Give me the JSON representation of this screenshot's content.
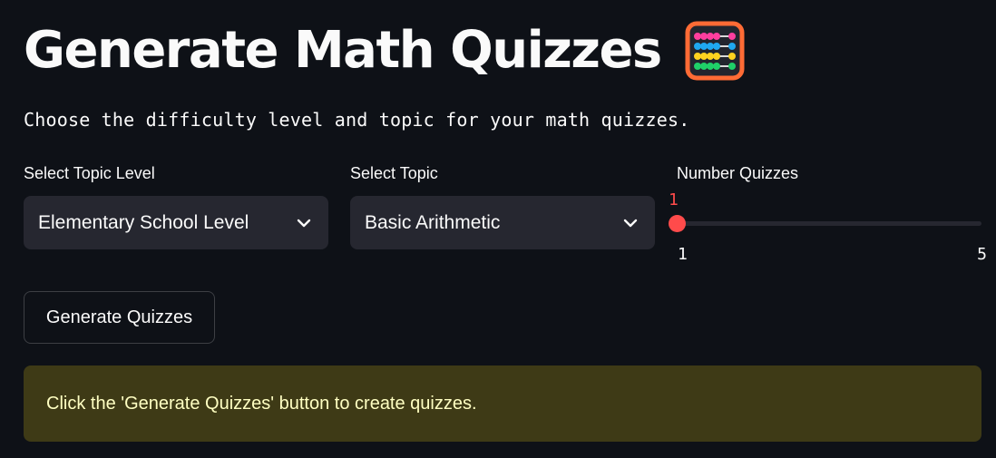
{
  "header": {
    "title": "Generate Math Quizzes",
    "title_icon": "abacus-icon",
    "subtitle": "Choose the difficulty level and topic for your math quizzes."
  },
  "controls": {
    "topic_level": {
      "label": "Select Topic Level",
      "value": "Elementary School Level",
      "icon": "chevron-down-icon"
    },
    "topic": {
      "label": "Select Topic",
      "value": "Basic Arithmetic",
      "icon": "chevron-down-icon"
    },
    "number_quizzes": {
      "label": "Number Quizzes",
      "value": "1",
      "min": "1",
      "max": "5"
    }
  },
  "actions": {
    "generate_label": "Generate Quizzes"
  },
  "alert": {
    "message": "Click the 'Generate Quizzes' button to create quizzes."
  },
  "colors": {
    "background": "#0e1117",
    "widget_bg": "#262730",
    "accent": "#ff4b4b",
    "alert_bg": "#3e3a16",
    "alert_text": "#ffffc2"
  }
}
